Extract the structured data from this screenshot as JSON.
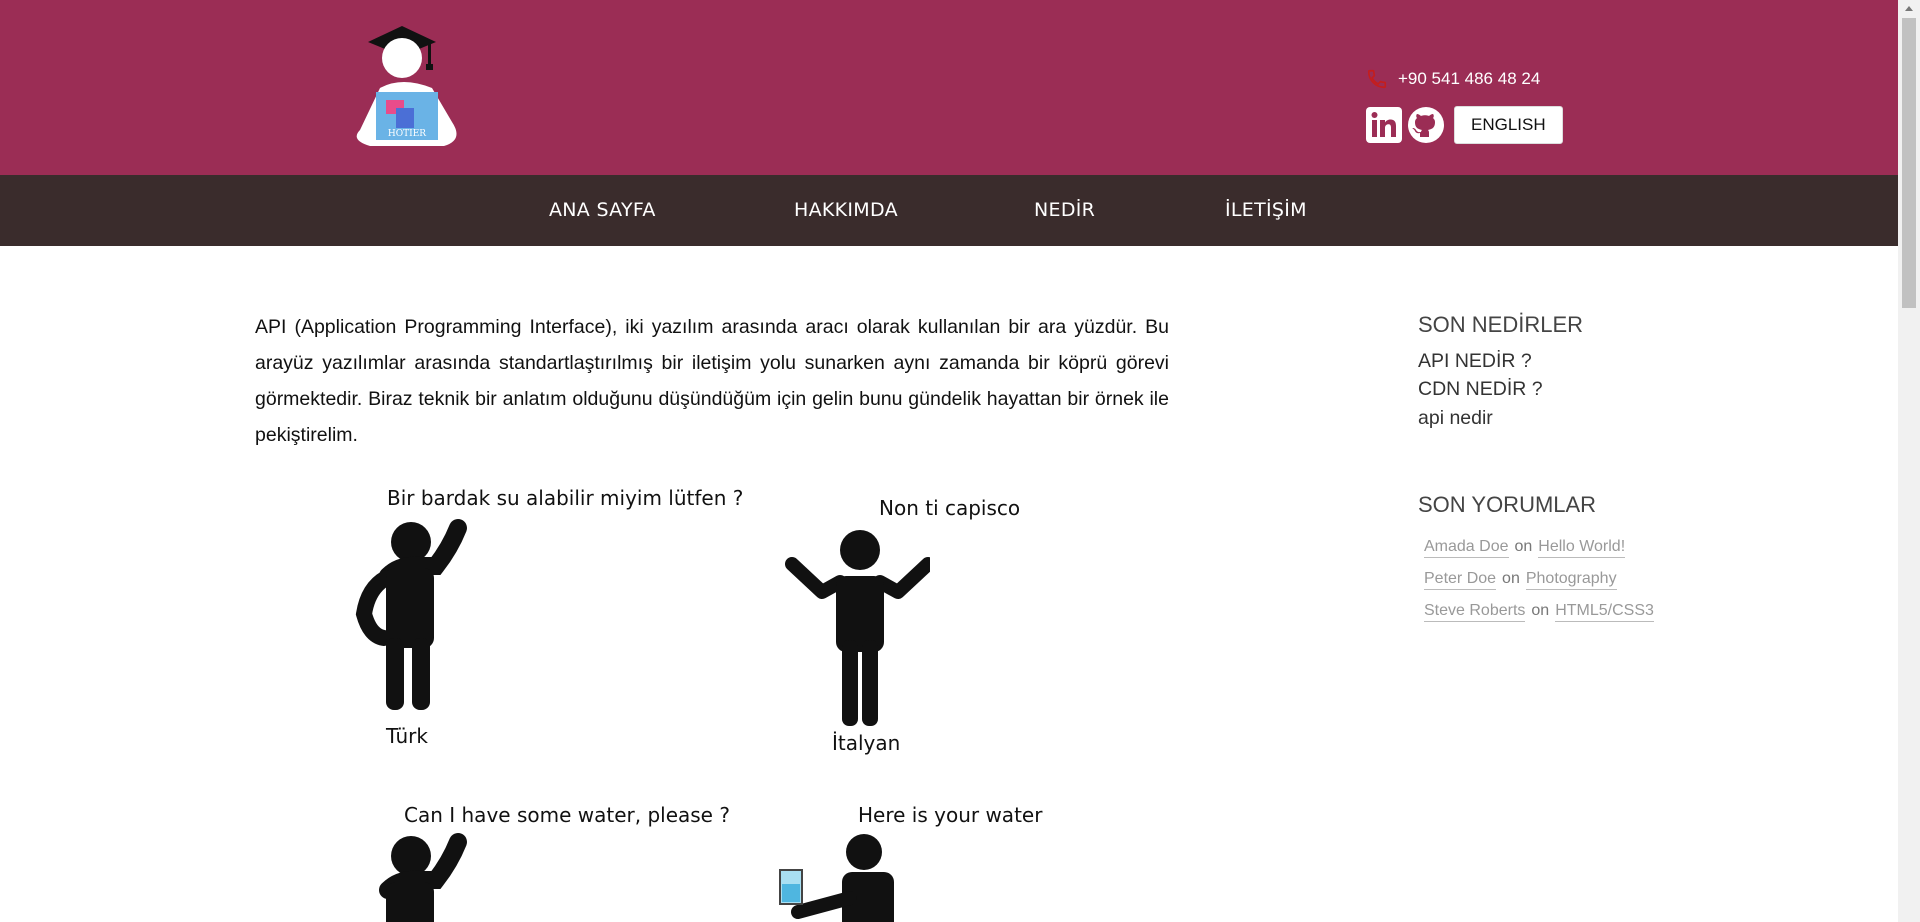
{
  "header": {
    "logo_text": "HOTIER",
    "phone": "+90 541 486 48 24",
    "social": [
      "linkedin-icon",
      "github-icon"
    ],
    "lang_button": "ENGLISH",
    "background_color": "#9b2d55"
  },
  "nav": {
    "items": [
      {
        "label": "ANA SAYFA"
      },
      {
        "label": "HAKKIMDA"
      },
      {
        "label": "NEDİR"
      },
      {
        "label": "İLETİŞİM"
      }
    ],
    "background_color": "#3a2c2c"
  },
  "article": {
    "paragraph": "API (Application Programming Interface), iki yazılım arasında aracı olarak kullanılan bir ara yüzdür. Bu arayüz yazılımlar arasında standartlaştırılmış bir iletişim yolu sunarken aynı zamanda bir köprü görevi görmektedir. Biraz teknik bir anlatım olduğunu düşündüğüm için gelin bunu gündelik hayattan bir örnek ile pekiştirelim.",
    "figure": {
      "speech_turk": "Bir bardak su alabilir miyim lütfen ?",
      "speech_italian": "Non ti capisco",
      "label_turk": "Türk",
      "label_italian": "İtalyan",
      "speech_english": "Can I have some water, please ?",
      "speech_reply": "Here is your water"
    }
  },
  "sidebar": {
    "recent_title": "SON NEDİRLER",
    "recent_links": [
      "API NEDİR ?",
      "CDN NEDİR ?",
      "api nedir"
    ],
    "comments_title": "SON YORUMLAR",
    "comments": [
      {
        "author": "Amada Doe",
        "on": "on",
        "post": "Hello World!"
      },
      {
        "author": "Peter Doe",
        "on": "on",
        "post": "Photography"
      },
      {
        "author": "Steve Roberts",
        "on": "on",
        "post": "HTML5/CSS3"
      }
    ]
  }
}
